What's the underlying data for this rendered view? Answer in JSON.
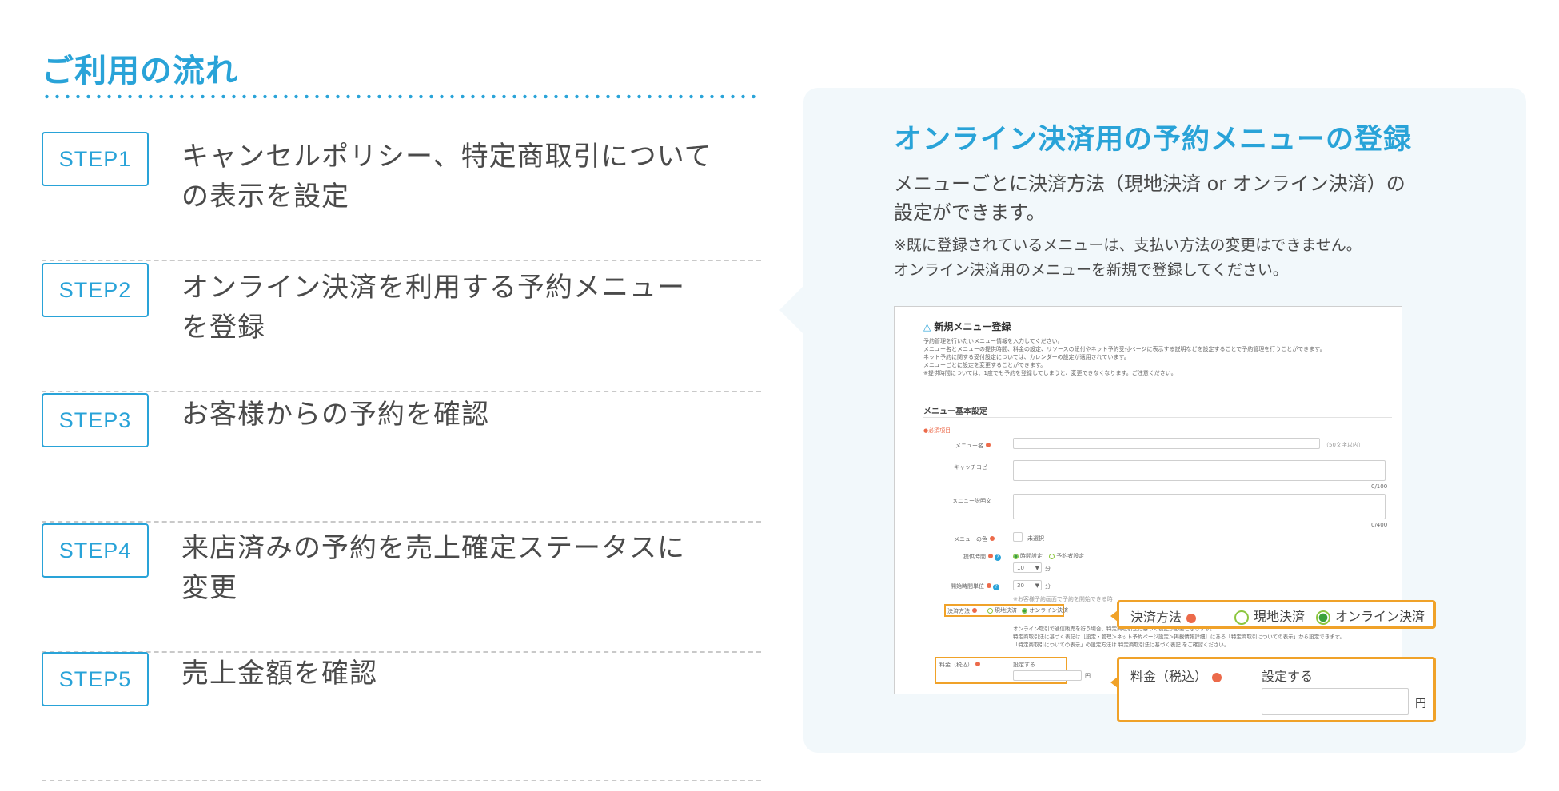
{
  "section_title": "ご利用の流れ",
  "steps": [
    {
      "badge": "STEP1",
      "text": "キャンセルポリシー、特定商取引について\nの表示を設定"
    },
    {
      "badge": "STEP2",
      "text": "オンライン決済を利用する予約メニュー\nを登録"
    },
    {
      "badge": "STEP3",
      "text": "お客様からの予約を確認"
    },
    {
      "badge": "STEP4",
      "text": "来店済みの予約を売上確定ステータスに\n変更"
    },
    {
      "badge": "STEP5",
      "text": "売上金額を確認"
    }
  ],
  "panel": {
    "title": "オンライン決済用の予約メニューの登録",
    "desc": "メニューごとに決済方法（現地決済 or オンライン決済）の\n設定ができます。",
    "note": "※既に登録されているメニューは、支払い方法の変更はできません。\nオンライン決済用のメニューを新規で登録してください。"
  },
  "mock": {
    "title": "新規メニュー登録",
    "intro": "予約管理を行いたいメニュー情報を入力してください。\nメニュー名とメニューの提供時間、料金の設定、リソースの紐付やネット予約受付ページに表示する説明などを設定することで予約管理を行うことができます。\nネット予約に関する受付設定については、カレンダーの設定が適用されています。\nメニューごとに設定を変更することができます。\n※提供時間については、1度でも予約を登録してしまうと、変更できなくなります。ご注意ください。",
    "section": "メニュー基本設定",
    "required_note": "●必須項目",
    "name_label": "メニュー名",
    "name_hint": "（50文字以内）",
    "catch_label": "キャッチコピー",
    "catch_count": "0/100",
    "desc_label": "メニュー説明文",
    "desc_count": "0/400",
    "color_label": "メニューの色",
    "color_value": "未選択",
    "duration_label": "提供時間",
    "duration_opt1": "時間設定",
    "duration_opt2": "予約者設定",
    "duration_value": "10",
    "duration_unit": "分",
    "start_label": "開始時間単位",
    "start_value": "30",
    "start_unit": "分",
    "start_hint": "※お客様予約画面で予約を開始できる時",
    "pay_label": "決済方法",
    "pay_opt1": "現地決済",
    "pay_opt2": "オンライン決済",
    "pay_note": "オンライン取引で通信販売を行う場合、特定商取引法に基づく表記が必要となります。\n特定商取引法に基づく表記は［設定・管理＞ネット予約ページ設定＞掲載情報詳細］にある「特定商取引についての表示」から設定できます。\n「特定商取引についての表示」の設定方法は 特定商取引法に基づく表記 をご確認ください。",
    "price_label": "料金（税込）",
    "price_set": "設定する",
    "price_unit": "円"
  },
  "callout_pay": {
    "label": "決済方法",
    "opt1": "現地決済",
    "opt2": "オンライン決済"
  },
  "callout_price": {
    "label": "料金（税込）",
    "set": "設定する",
    "unit": "円"
  }
}
